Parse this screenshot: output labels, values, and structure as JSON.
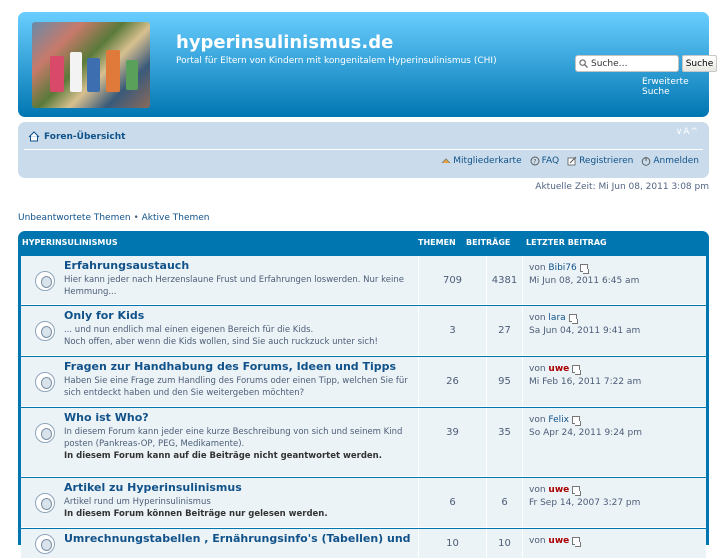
{
  "header": {
    "title": "hyperinsulinismus.de",
    "description": "Portal für Eltern von Kindern mit kongenitalem Hyperinsulinismus (CHI)",
    "search_placeholder": "Suche…",
    "search_button": "Suche",
    "advanced_search": "Erweiterte Suche"
  },
  "nav": {
    "home": "Foren-Übersicht",
    "font_controls": "∨A^",
    "links": [
      {
        "icon": "members-icon",
        "label": "Mitgliederkarte"
      },
      {
        "icon": "faq-icon",
        "label": "FAQ"
      },
      {
        "icon": "register-icon",
        "label": "Registrieren"
      },
      {
        "icon": "login-icon",
        "label": "Anmelden"
      }
    ]
  },
  "time": "Aktuelle Zeit: Mi Jun 08, 2011 3:08 pm",
  "quick_links": {
    "unanswered": "Unbeantwortete Themen",
    "sep": " • ",
    "active": "Aktive Themen"
  },
  "forum_list": {
    "header": {
      "category": "Hyperinsulinismus",
      "topics": "Themen",
      "posts": "Beiträge",
      "last_post": "Letzter Beitrag"
    },
    "forums": [
      {
        "title": "Erfahrungsaustauch",
        "desc": [
          "Hier kann jeder nach Herzenslaune Frust und Erfahrungen loswerden. Nur keine Hemmung..."
        ],
        "note": "",
        "topics": "709",
        "posts": "4381",
        "by": "von",
        "user": "Bibi76",
        "user_red": false,
        "date": "Mi Jun 08, 2011 6:45 am"
      },
      {
        "title": "Only for Kids",
        "desc": [
          "... und nun endlich mal einen eigenen Bereich für die Kids.",
          "Noch offen, aber wenn die Kids wollen, sind Sie auch ruckzuck unter sich!"
        ],
        "note": "",
        "topics": "3",
        "posts": "27",
        "by": "von",
        "user": "lara",
        "user_red": false,
        "date": "Sa Jun 04, 2011 9:41 am"
      },
      {
        "title": "Fragen zur Handhabung des Forums, Ideen und Tipps",
        "desc": [
          "Haben Sie eine Frage zum Handling des Forums oder einen Tipp, welchen Sie für sich entdeckt haben und den Sie weitergeben möchten?"
        ],
        "note": "",
        "topics": "26",
        "posts": "95",
        "by": "von",
        "user": "uwe",
        "user_red": true,
        "date": "Mi Feb 16, 2011 7:22 am"
      },
      {
        "title": "Who ist Who?",
        "desc": [
          "In diesem Forum kann jeder eine kurze Beschreibung von sich und seinem Kind posten (Pankreas-OP, PEG, Medikamente)."
        ],
        "note": "In diesem Forum kann auf die Beiträge nicht geantwortet werden.",
        "topics": "39",
        "posts": "35",
        "by": "von",
        "user": "Felix",
        "user_red": false,
        "date": "So Apr 24, 2011 9:24 pm"
      },
      {
        "title": "Artikel zu Hyperinsulinismus",
        "desc": [
          "Artikel rund um Hyperinsulinismus"
        ],
        "note": "In diesem Forum können Beiträge nur gelesen werden.",
        "topics": "6",
        "posts": "6",
        "by": "von",
        "user": "uwe",
        "user_red": true,
        "date": "Fr Sep 14, 2007 3:27 pm"
      },
      {
        "title": "Umrechnungstabellen , Ernährungsinfo's (Tabellen) und",
        "desc": [],
        "note": "",
        "topics": "10",
        "posts": "10",
        "by": "von",
        "user": "uwe",
        "user_red": true,
        "date": ""
      }
    ]
  }
}
